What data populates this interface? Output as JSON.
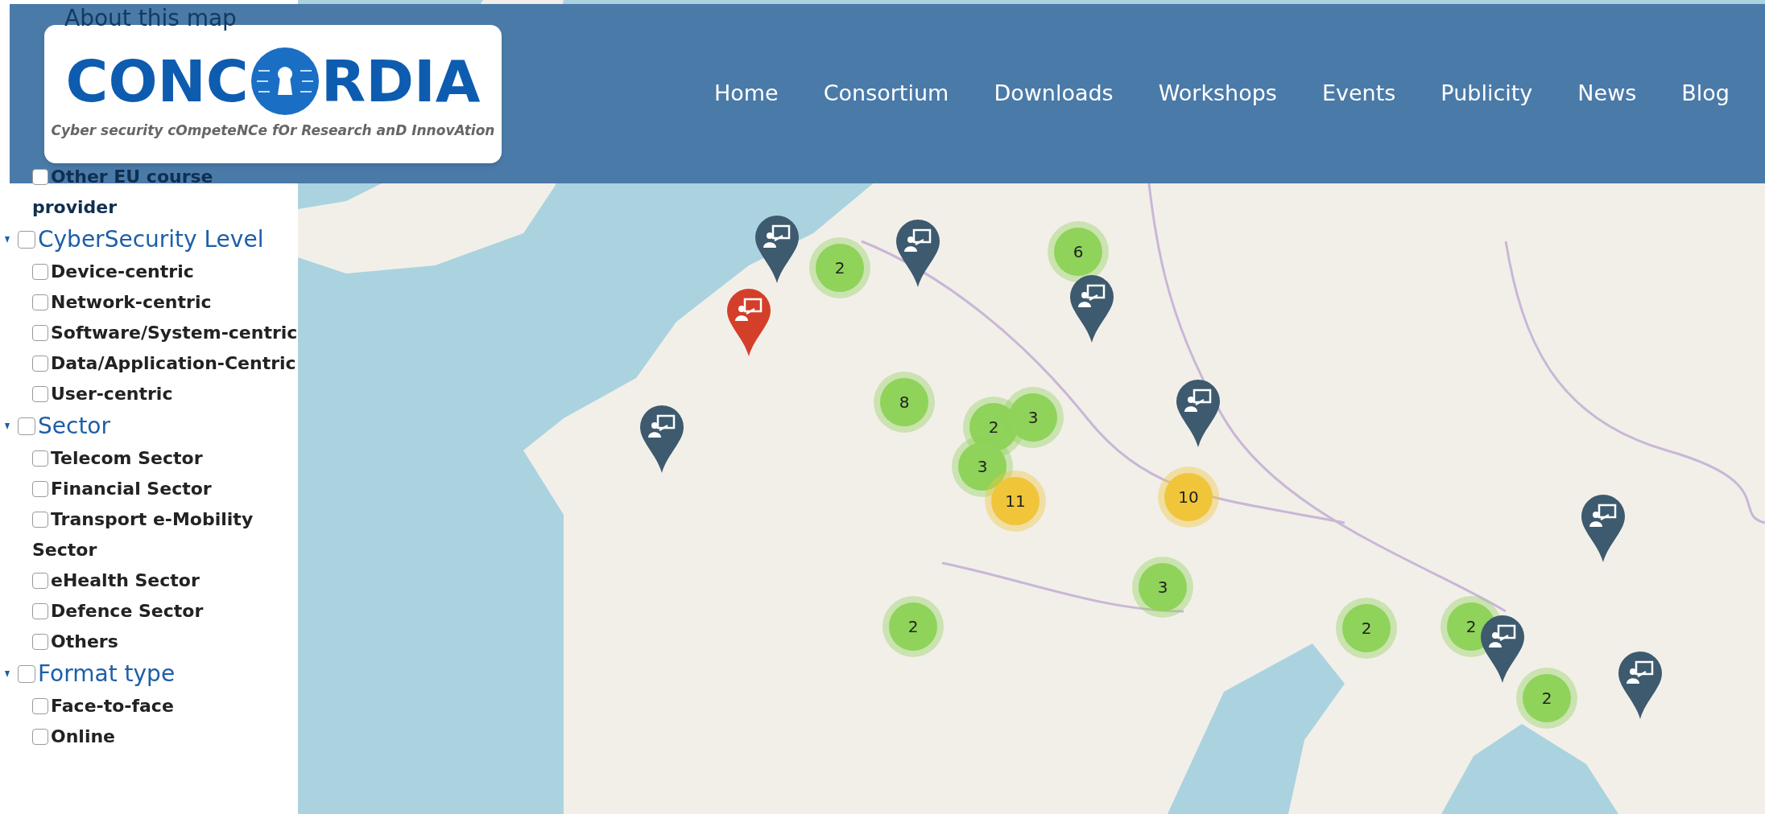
{
  "header": {
    "logo": {
      "text_before": "CONC",
      "text_after": "RDIA",
      "tagline": "Cyber security cOmpeteNCe fOr Research anD InnovAtion"
    },
    "nav": [
      {
        "label": "Home"
      },
      {
        "label": "Consortium"
      },
      {
        "label": "Downloads"
      },
      {
        "label": "Workshops"
      },
      {
        "label": "Events"
      },
      {
        "label": "Publicity"
      },
      {
        "label": "News"
      },
      {
        "label": "Blog"
      }
    ]
  },
  "sidebar": {
    "about_link": "About this map",
    "groups": [
      {
        "kind": "list",
        "items": [
          {
            "label": "Other EU course provider",
            "checked": false
          }
        ]
      },
      {
        "kind": "group",
        "title": "CyberSecurity Level",
        "checked": false,
        "items": [
          {
            "label": "Device-centric",
            "checked": false
          },
          {
            "label": "Network-centric",
            "checked": false
          },
          {
            "label": "Software/System-centric",
            "checked": false
          },
          {
            "label": "Data/Application-Centric",
            "checked": false
          },
          {
            "label": "User-centric",
            "checked": false
          }
        ]
      },
      {
        "kind": "group",
        "title": "Sector",
        "checked": false,
        "items": [
          {
            "label": "Telecom Sector",
            "checked": false
          },
          {
            "label": "Financial Sector",
            "checked": false
          },
          {
            "label": "Transport e-Mobility Sector",
            "checked": false
          },
          {
            "label": "eHealth Sector",
            "checked": false
          },
          {
            "label": "Defence Sector",
            "checked": false
          },
          {
            "label": "Others",
            "checked": false
          }
        ]
      },
      {
        "kind": "group",
        "title": "Format type",
        "checked": false,
        "items": [
          {
            "label": "Face-to-face",
            "checked": false
          },
          {
            "label": "Online",
            "checked": false
          }
        ]
      }
    ]
  },
  "map": {
    "markers": [
      {
        "kind": "cluster",
        "count": "2",
        "color": "#8fd35a"
      },
      {
        "kind": "cluster",
        "count": "6",
        "color": "#8fd35a"
      },
      {
        "kind": "cluster",
        "count": "8",
        "color": "#8fd35a"
      },
      {
        "kind": "cluster",
        "count": "2",
        "color": "#8fd35a"
      },
      {
        "kind": "cluster",
        "count": "3",
        "color": "#8fd35a"
      },
      {
        "kind": "cluster",
        "count": "3",
        "color": "#8fd35a"
      },
      {
        "kind": "cluster",
        "count": "11",
        "color": "#f0c53a"
      },
      {
        "kind": "cluster",
        "count": "10",
        "color": "#f0c53a"
      },
      {
        "kind": "cluster",
        "count": "3",
        "color": "#8fd35a"
      },
      {
        "kind": "cluster",
        "count": "2",
        "color": "#8fd35a"
      },
      {
        "kind": "cluster",
        "count": "2",
        "color": "#8fd35a"
      },
      {
        "kind": "cluster",
        "count": "2",
        "color": "#8fd35a"
      },
      {
        "kind": "cluster",
        "count": "2",
        "color": "#8fd35a"
      },
      {
        "kind": "pin",
        "color": "#3d5a6e"
      },
      {
        "kind": "pin",
        "color": "#3d5a6e"
      },
      {
        "kind": "pin",
        "color": "#3d5a6e"
      },
      {
        "kind": "pin",
        "color": "#d43f2a"
      },
      {
        "kind": "pin",
        "color": "#3d5a6e"
      },
      {
        "kind": "pin",
        "color": "#3d5a6e"
      },
      {
        "kind": "pin",
        "color": "#3d5a6e"
      },
      {
        "kind": "pin",
        "color": "#3d5a6e"
      },
      {
        "kind": "pin",
        "color": "#3d5a6e"
      }
    ]
  }
}
